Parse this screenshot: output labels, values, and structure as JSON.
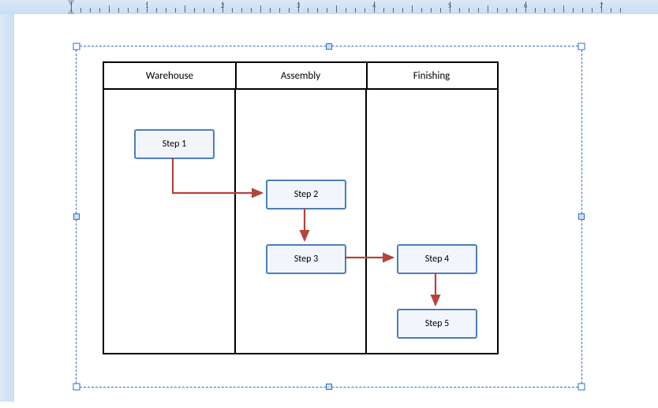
{
  "ruler": {
    "numbers": [
      "1",
      "2",
      "3",
      "4",
      "5",
      "6",
      "7"
    ]
  },
  "swimlanes": {
    "headers": [
      "Warehouse",
      "Assembly",
      "Finishing"
    ]
  },
  "steps": {
    "s1": "Step 1",
    "s2": "Step 2",
    "s3": "Step 3",
    "s4": "Step 4",
    "s5": "Step 5"
  },
  "chart_data": {
    "type": "diagram",
    "lanes": [
      "Warehouse",
      "Assembly",
      "Finishing"
    ],
    "nodes": [
      {
        "id": "s1",
        "label": "Step 1",
        "lane": "Warehouse"
      },
      {
        "id": "s2",
        "label": "Step 2",
        "lane": "Assembly"
      },
      {
        "id": "s3",
        "label": "Step 3",
        "lane": "Assembly"
      },
      {
        "id": "s4",
        "label": "Step 4",
        "lane": "Finishing"
      },
      {
        "id": "s5",
        "label": "Step 5",
        "lane": "Finishing"
      }
    ],
    "edges": [
      {
        "from": "s1",
        "to": "s2"
      },
      {
        "from": "s2",
        "to": "s3"
      },
      {
        "from": "s3",
        "to": "s4"
      },
      {
        "from": "s4",
        "to": "s5"
      }
    ]
  }
}
